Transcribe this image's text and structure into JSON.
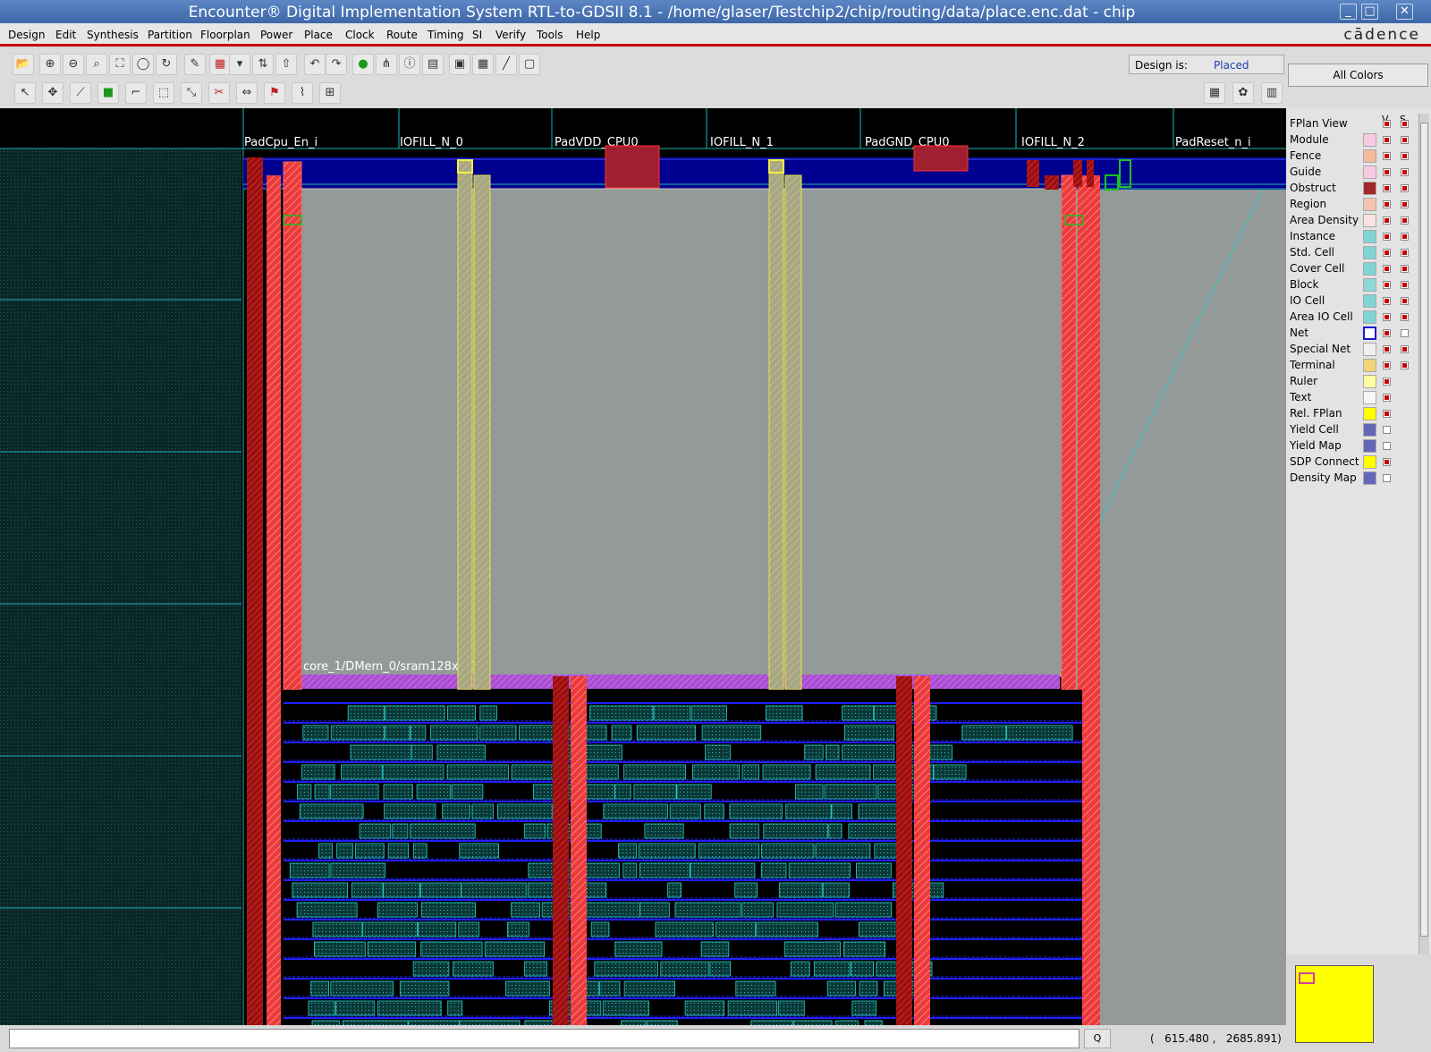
{
  "window": {
    "title": "Encounter® Digital Implementation System RTL-to-GDSII 8.1 - /home/glaser/Testchip2/chip/routing/data/place.enc.dat - chip",
    "minimize_glyph": "_",
    "maximize_glyph": "□",
    "close_glyph": "✕"
  },
  "menu": {
    "items": [
      "Design",
      "Edit",
      "Synthesis",
      "Partition",
      "Floorplan",
      "Power",
      "Place",
      "Clock",
      "Route",
      "Timing",
      "SI",
      "Verify",
      "Tools",
      "Help"
    ],
    "logo": "cādence"
  },
  "toolbar": {
    "row1_icons": [
      "open-folder-icon",
      "zoom-in-icon",
      "zoom-out-icon",
      "zoom-area-icon",
      "fit-icon",
      "zoom-previous-icon",
      "refresh-icon",
      "select-color-icon",
      "pattern-icon",
      "dropdown-icon",
      "up-down-arrow-icon",
      "up-arrow-icon",
      "undo-icon",
      "redo-icon",
      "green-circle-icon",
      "hierarchy-icon",
      "info-icon",
      "page-icon",
      "folder-icon",
      "grid-icon",
      "ruler-icon",
      "monitor-icon"
    ],
    "row2_icons": [
      "pointer-icon",
      "move-icon",
      "ruler-diag-icon",
      "green-square-icon",
      "angle-icon",
      "select-box-icon",
      "resize-icon",
      "cut-icon",
      "stretch-icon",
      "flag-icon",
      "wire-icon",
      "net-icon"
    ],
    "right_icons": [
      "floorplan-view-icon",
      "amoeba-view-icon",
      "physical-view-icon"
    ]
  },
  "design_status": {
    "label": "Design is:",
    "value": "Placed"
  },
  "colors_button": {
    "label": "All Colors"
  },
  "legend": {
    "col_v": "V",
    "col_s": "S",
    "rows": [
      {
        "name": "FPlan View",
        "swatch": null,
        "v": true,
        "s": true
      },
      {
        "name": "Module",
        "swatch": "#f7cbe3",
        "v": true,
        "s": true
      },
      {
        "name": "Fence",
        "swatch": "#f7b99a",
        "v": true,
        "s": true
      },
      {
        "name": "Guide",
        "swatch": "#f7cbe3",
        "v": true,
        "s": true
      },
      {
        "name": "Obstruct",
        "swatch": "#a3262b",
        "v": true,
        "s": true
      },
      {
        "name": "Region",
        "swatch": "#f4c4b0",
        "v": true,
        "s": true
      },
      {
        "name": "Area Density",
        "swatch": "#f7e3e3",
        "v": true,
        "s": true
      },
      {
        "name": "Instance",
        "swatch": "#7fd4d4",
        "v": true,
        "s": true
      },
      {
        "name": "Std. Cell",
        "swatch": "#7fd4d4",
        "v": true,
        "s": true
      },
      {
        "name": "Cover Cell",
        "swatch": "#7fd4d4",
        "v": true,
        "s": true
      },
      {
        "name": "Block",
        "swatch": "#8fd8d8",
        "v": true,
        "s": true
      },
      {
        "name": "IO Cell",
        "swatch": "#7fd4d4",
        "v": true,
        "s": true
      },
      {
        "name": "Area IO Cell",
        "swatch": "#7fd4d4",
        "v": true,
        "s": true
      },
      {
        "name": "Net",
        "swatch": "#ffffff",
        "v": true,
        "s": false
      },
      {
        "name": "Special Net",
        "swatch": "#f0f0f0",
        "v": true,
        "s": true
      },
      {
        "name": "Terminal",
        "swatch": "#f2d27a",
        "v": true,
        "s": true
      },
      {
        "name": "Ruler",
        "swatch": "#ffffa0",
        "v": true,
        "s": null
      },
      {
        "name": "Text",
        "swatch": "#f6f6f6",
        "v": true,
        "s": null
      },
      {
        "name": "Rel. FPlan",
        "swatch": "#ffff00",
        "v": true,
        "s": null
      },
      {
        "name": "Yield Cell",
        "swatch": "#6466b8",
        "v": false,
        "s": null
      },
      {
        "name": "Yield Map",
        "swatch": "#6466b8",
        "v": false,
        "s": null
      },
      {
        "name": "SDP Connect",
        "swatch": "#ffff00",
        "v": true,
        "s": null
      },
      {
        "name": "Density Map",
        "swatch": "#6466b8",
        "v": false,
        "s": null
      }
    ]
  },
  "canvas": {
    "io_pads": [
      "PadCpu_En_i",
      "IOFILL_N_0",
      "PadVDD_CPU0",
      "IOFILL_N_1",
      "PadGND_CPU0",
      "IOFILL_N_2",
      "PadReset_n_i"
    ],
    "block_label": "core_1/DMem_0/sram128x8_1"
  },
  "status": {
    "command_value": "",
    "query_button": "Q",
    "coord_x": "615.480",
    "coord_y": "2685.891"
  }
}
